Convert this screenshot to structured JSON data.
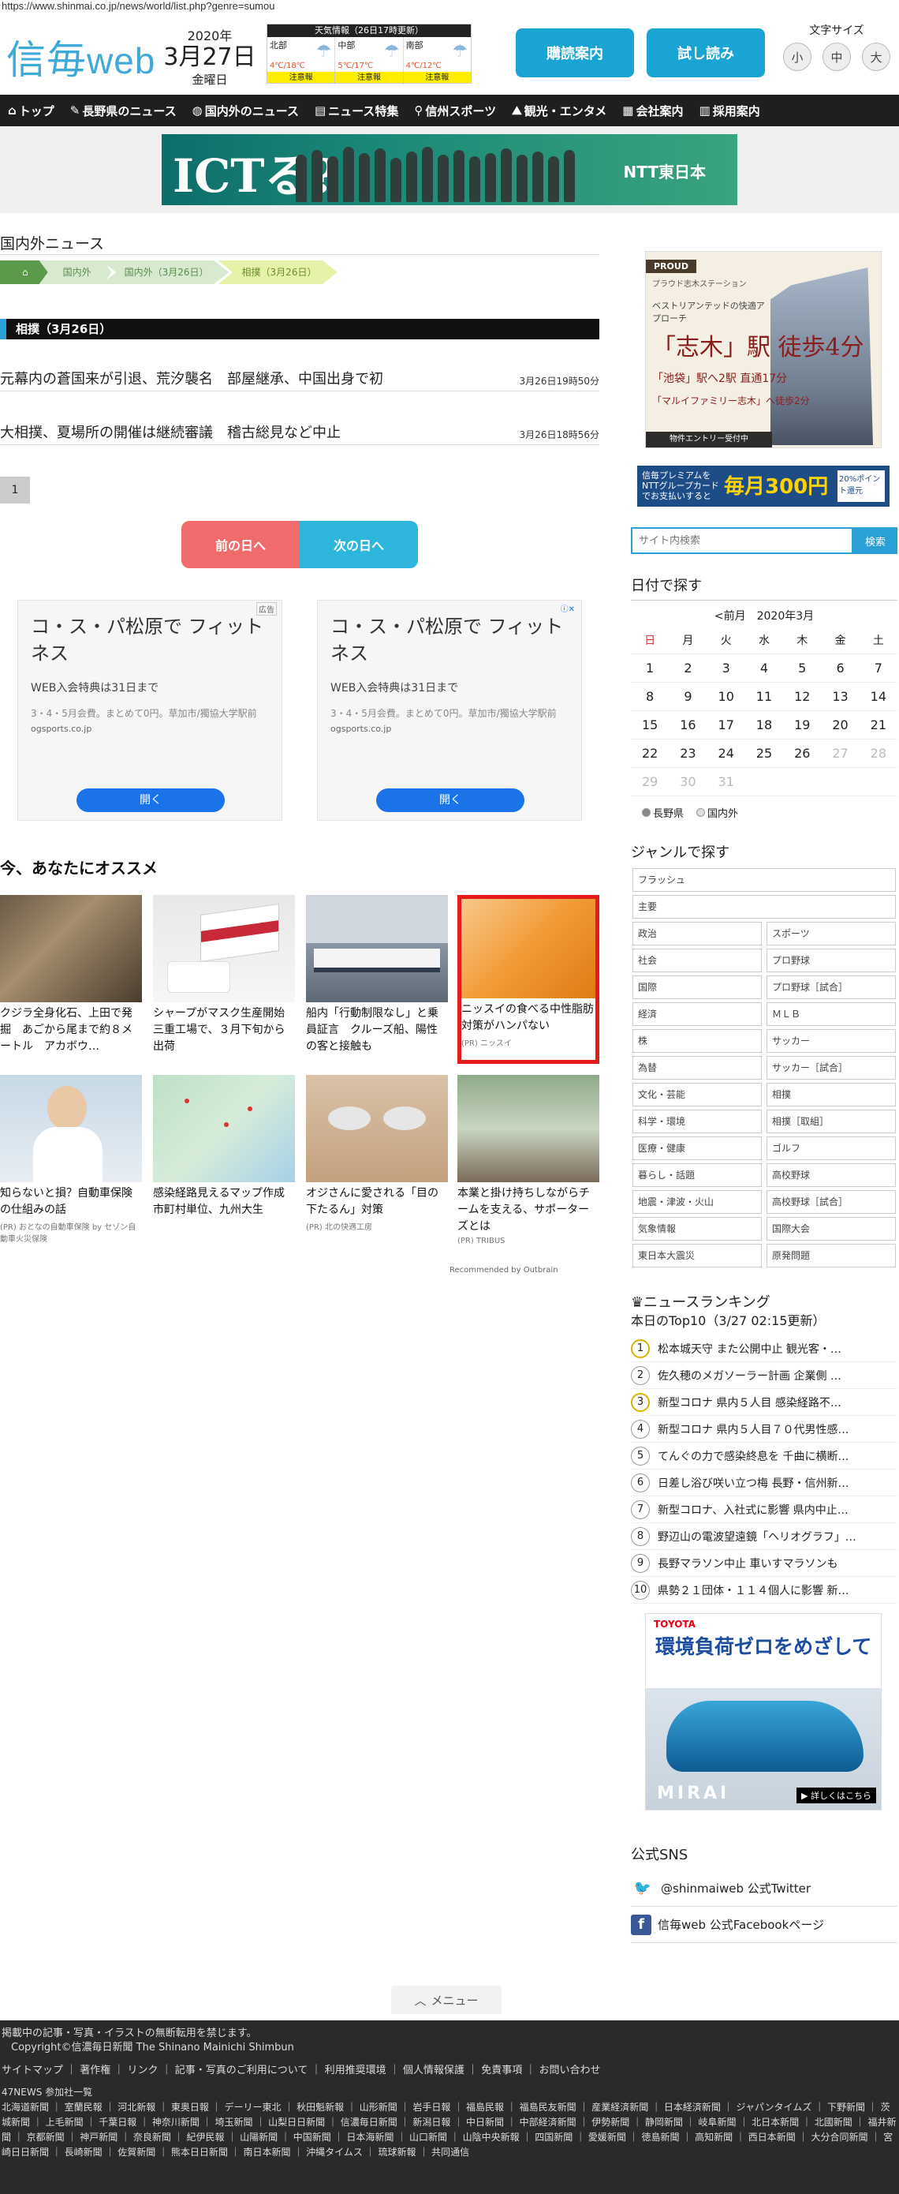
{
  "url": "https://www.shinmai.co.jp/news/world/list.php?genre=sumou",
  "header": {
    "logo_kanji": "信毎",
    "logo_web": "web",
    "year": "2020年",
    "month_day": "3月27日",
    "weekday": "金曜日",
    "weather": {
      "title": "天気情報（26日17時更新）",
      "regions": [
        {
          "name": "北部",
          "temp": "4℃/18℃",
          "alert": "注意報"
        },
        {
          "name": "中部",
          "temp": "5℃/17℃",
          "alert": "注意報"
        },
        {
          "name": "南部",
          "temp": "4℃/12℃",
          "alert": "注意報"
        }
      ]
    },
    "subscribe_label": "購読案内",
    "trial_label": "試し読み",
    "fontsize_label": "文字サイズ",
    "fontsize_options": [
      "小",
      "中",
      "大"
    ]
  },
  "nav": [
    {
      "icon": "home-icon",
      "glyph": "⌂",
      "label": "トップ"
    },
    {
      "icon": "pen-icon",
      "glyph": "✎",
      "label": "長野県のニュース"
    },
    {
      "icon": "globe-icon",
      "glyph": "◍",
      "label": "国内外のニュース"
    },
    {
      "icon": "doc-icon",
      "glyph": "▤",
      "label": "ニュース特集"
    },
    {
      "icon": "bike-icon",
      "glyph": "⚲",
      "label": "信州スポーツ"
    },
    {
      "icon": "camera-icon",
      "glyph": "⛰",
      "label": "観光・エンタメ"
    },
    {
      "icon": "building-icon",
      "glyph": "▦",
      "label": "会社案内"
    },
    {
      "icon": "id-icon",
      "glyph": "▥",
      "label": "採用案内"
    }
  ],
  "banner": {
    "headline": "ICTる?",
    "brand": "NTT東日本"
  },
  "main": {
    "section_title": "国内外ニュース",
    "breadcrumbs": [
      "国内外",
      "国内外（3月26日）",
      "相撲（3月26日）"
    ],
    "category_bar": "相撲（3月26日）",
    "articles": [
      {
        "title": "元幕内の蒼国来が引退、荒汐襲名　部屋継承、中国出身で初",
        "time": "3月26日19時50分"
      },
      {
        "title": "大相撲、夏場所の開催は継続審議　稽古総見など中止",
        "time": "3月26日18時56分"
      }
    ],
    "page_number": "1",
    "prev_label": "前の日へ",
    "next_label": "次の日へ",
    "ads": [
      {
        "tag": "広告",
        "title": "コ・ス・パ松原で フィットネス",
        "line1": "WEB入会特典は31日まで",
        "line2": "3・4・5月会費。まとめて0円。草加市/獨協大学駅前",
        "domain": "ogsports.co.jp",
        "button": "開く"
      },
      {
        "tag": "ⓘ✕",
        "title": "コ・ス・パ松原で フィットネス",
        "line1": "WEB入会特典は31日まで",
        "line2": "3・4・5月会費。まとめて0円。草加市/獨協大学駅前",
        "domain": "ogsports.co.jp",
        "button": "開く"
      }
    ],
    "recommend_title": "今、あなたにオススメ",
    "recommend": [
      {
        "caption": "クジラ全身化石、上田で発掘　あごから尾まで約８メートル　アカボウ…",
        "pr": ""
      },
      {
        "caption": "シャープがマスク生産開始　三重工場で、３月下旬から出荷",
        "pr": ""
      },
      {
        "caption": "船内「行動制限なし」と乗員証言　クルーズ船、陽性の客と接触も",
        "pr": ""
      },
      {
        "caption": "ニッスイの食べる中性脂肪対策がハンパない",
        "pr": "(PR) ニッスイ"
      },
      {
        "caption": "知らないと損？自動車保険の仕組みの話",
        "pr": "(PR) おとなの自動車保険 by セゾン自動車火災保険"
      },
      {
        "caption": "感染経路見えるマップ作成　市町村単位、九州大生",
        "pr": ""
      },
      {
        "caption": "オジさんに愛される「目の下たるん」対策",
        "pr": "(PR) 北の快適工房"
      },
      {
        "caption": "本業と掛け持ちしながらチームを支える、サポーターズとは",
        "pr": "(PR) TRIBUS"
      }
    ],
    "outbrain": "Recommended by Outbrain"
  },
  "sidebar": {
    "proud_ad": {
      "brand": "PROUD",
      "sub": "プラウド志木ステーション",
      "tagline": "ベストリアンテッドの快適アプローチ",
      "big": "「志木」駅 徒歩4分",
      "line2": "「池袋」駅へ2駅 直通17分",
      "line3": "「マルイファミリー志木」へ徒歩2分",
      "foot": "物件エントリー受付中"
    },
    "premium_ad": {
      "a": "信毎プレミアムを NTTグループカードでお支払いすると",
      "b": "毎月300円",
      "c": "20%ポイント還元"
    },
    "search_placeholder": "サイト内検索",
    "search_button": "検索",
    "date_title": "日付で探す",
    "calendar_prev": "<前月",
    "calendar_month": "2020年3月",
    "weekdays": [
      "日",
      "月",
      "火",
      "水",
      "木",
      "金",
      "土"
    ],
    "weeks": [
      [
        "1",
        "2",
        "3",
        "4",
        "5",
        "6",
        "7"
      ],
      [
        "8",
        "9",
        "10",
        "11",
        "12",
        "13",
        "14"
      ],
      [
        "15",
        "16",
        "17",
        "18",
        "19",
        "20",
        "21"
      ],
      [
        "22",
        "23",
        "24",
        "25",
        "26",
        "27",
        "28"
      ],
      [
        "29",
        "30",
        "31",
        "",
        "",
        "",
        ""
      ]
    ],
    "radio_options": [
      "長野県",
      "国内外"
    ],
    "genre_title": "ジャンルで探す",
    "genre_full": [
      "フラッシュ",
      "主要"
    ],
    "genres": [
      "政治",
      "スポーツ",
      "社会",
      "プロ野球",
      "国際",
      "プロ野球［試合］",
      "経済",
      "ＭＬＢ",
      "株",
      "サッカー",
      "為替",
      "サッカー［試合］",
      "文化・芸能",
      "相撲",
      "科学・環境",
      "相撲［取組］",
      "医療・健康",
      "ゴルフ",
      "暮らし・話題",
      "高校野球",
      "地震・津波・火山",
      "高校野球［試合］",
      "気象情報",
      "国際大会",
      "東日本大震災",
      "原発問題"
    ],
    "ranking_title": "ニュースランキング",
    "ranking_sub": "本日のTop10（3/27 02:15更新）",
    "ranking": [
      "松本城天守 また公開中止 観光客・…",
      "佐久穂のメガソーラー計画 企業側 …",
      "新型コロナ 県内５人目 感染経路不…",
      "新型コロナ 県内５人目７０代男性感…",
      "てんぐの力で感染終息を 千曲に横断…",
      "日差し浴び咲い立つ梅 長野・信州新…",
      "新型コロナ、入社式に影響 県内中止…",
      "野辺山の電波望遠鏡「ヘリオグラフ」…",
      "長野マラソン中止 車いすマラソンも",
      "県勢２１団体・１１４個人に影響 新…"
    ],
    "toyota_ad": {
      "brand": "TOYOTA",
      "tagline": "環境負荷ゼロをめざして",
      "model": "MIRAI",
      "more": "▶ 詳しくはこちら"
    },
    "sns_title": "公式SNS",
    "sns": [
      {
        "label": "@shinmaiweb 公式Twitter",
        "icon": "twitter-icon"
      },
      {
        "label": "信毎web 公式Facebookページ",
        "icon": "facebook-icon"
      }
    ]
  },
  "menu_label": "メニュー",
  "footer": {
    "notice": "掲載中の記事・写真・イラストの無断転用を禁じます。",
    "copyright": "Copyright©信濃毎日新聞 The Shinano Mainichi Shimbun",
    "links": "サイトマップ ｜ 著作権 ｜ リンク ｜ 記事・写真のご利用について ｜ 利用推奨環境 ｜ 個人情報保護 ｜ 免責事項 ｜ お問い合わせ",
    "news47_title": "47NEWS 参加社一覧",
    "news47": "北海道新聞 ｜ 室蘭民報 ｜ 河北新報 ｜ 東奥日報 ｜ デーリー東北 ｜ 秋田魁新報 ｜ 山形新聞 ｜ 岩手日報 ｜ 福島民報 ｜ 福島民友新聞 ｜ 産業経済新聞 ｜ 日本経済新聞 ｜ ジャパンタイムズ ｜ 下野新聞 ｜ 茨城新聞 ｜ 上毛新聞 ｜ 千葉日報 ｜ 神奈川新聞 ｜ 埼玉新聞 ｜ 山梨日日新聞 ｜ 信濃毎日新聞 ｜ 新潟日報 ｜ 中日新聞 ｜ 中部経済新聞 ｜ 伊勢新聞 ｜ 静岡新聞 ｜ 岐阜新聞 ｜ 北日本新聞 ｜ 北國新聞 ｜ 福井新聞 ｜ 京都新聞 ｜ 神戸新聞 ｜ 奈良新聞 ｜ 紀伊民報 ｜ 山陽新聞 ｜ 中国新聞 ｜ 日本海新聞 ｜ 山口新聞 ｜ 山陰中央新報 ｜ 四国新聞 ｜ 愛媛新聞 ｜ 徳島新聞 ｜ 高知新聞 ｜ 西日本新聞 ｜ 大分合同新聞 ｜ 宮崎日日新聞 ｜ 長崎新聞 ｜ 佐賀新聞 ｜ 熊本日日新聞 ｜ 南日本新聞 ｜ 沖縄タイムス ｜ 琉球新報 ｜ 共同通信"
  },
  "colors": {
    "accent": "#1aa4d4",
    "nav_bg": "#1f1f1f",
    "prev": "#f06b6b",
    "next": "#2eb5dc"
  }
}
